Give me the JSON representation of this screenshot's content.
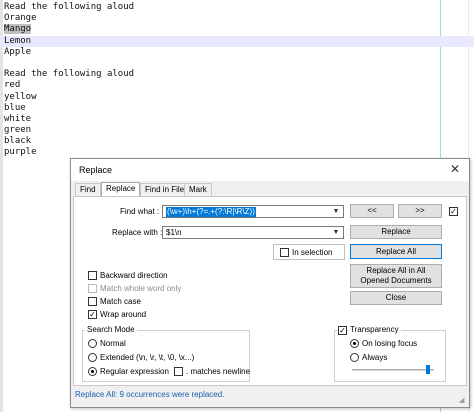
{
  "editor": {
    "lines": [
      {
        "text": "Read the following aloud"
      },
      {
        "text": "Orange"
      },
      {
        "text": "Mango",
        "selected": true
      },
      {
        "text": "Lemon",
        "current": true
      },
      {
        "text": "Apple"
      },
      {
        "text": ""
      },
      {
        "text": "Read the following aloud"
      },
      {
        "text": "red"
      },
      {
        "text": "yellow"
      },
      {
        "text": "blue"
      },
      {
        "text": "white"
      },
      {
        "text": "green"
      },
      {
        "text": "black"
      },
      {
        "text": "purple"
      }
    ]
  },
  "dialog": {
    "title": "Replace",
    "tabs": [
      {
        "label": "Find",
        "active": false
      },
      {
        "label": "Replace",
        "active": true
      },
      {
        "label": "Find in Files",
        "active": false
      },
      {
        "label": "Mark",
        "active": false
      }
    ],
    "find_label": "Find what :",
    "find_value": "(\\w+)\\h+(?=.+(?:\\R|\\R\\Z))",
    "replace_label": "Replace with :",
    "replace_value": "$1\\n",
    "buttons": {
      "prev": "<<",
      "next": ">>",
      "replace": "Replace",
      "replace_all": "Replace All",
      "replace_all_opened": "Replace All in All Opened Documents",
      "close": "Close"
    },
    "in_selection_label": "In selection",
    "options": [
      {
        "label": "Backward direction",
        "checked": false,
        "disabled": false
      },
      {
        "label": "Match whole word only",
        "checked": false,
        "disabled": true
      },
      {
        "label": "Match case",
        "checked": false,
        "disabled": false
      },
      {
        "label": "Wrap around",
        "checked": true,
        "disabled": false
      }
    ],
    "search_mode": {
      "title": "Search Mode",
      "normal": "Normal",
      "extended": "Extended (\\n, \\r, \\t, \\0, \\x...)",
      "regex": "Regular expression",
      "matches_newline": ". matches newline",
      "selected": "regex"
    },
    "transparency": {
      "title": "Transparency",
      "enabled": true,
      "on_losing_focus": "On losing focus",
      "always": "Always",
      "selected": "on_losing_focus",
      "level": 0.95
    },
    "status": "Replace All: 9 occurrences were replaced.",
    "colors": {
      "accent": "#0078d7",
      "status": "#1a5fb4"
    }
  }
}
